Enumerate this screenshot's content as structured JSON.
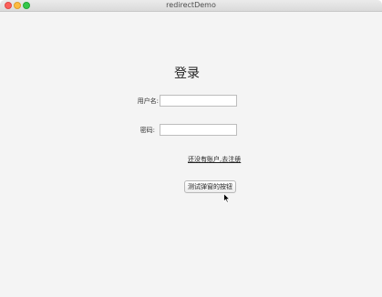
{
  "window": {
    "title": "redirectDemo"
  },
  "login": {
    "heading": "登录",
    "username_label": "用户名:",
    "username_value": "",
    "password_label": "密码:",
    "password_value": "",
    "register_link": "还没有账户,去注册",
    "test_button_label": "测试弹窗的按钮"
  },
  "icons": {
    "close": "close-icon",
    "minimize": "minimize-icon",
    "maximize": "maximize-icon",
    "cursor": "mouse-cursor-icon"
  },
  "colors": {
    "window_background": "#f4f4f4",
    "close": "#fc605c",
    "minimize": "#fdbc40",
    "maximize": "#34c84a"
  }
}
